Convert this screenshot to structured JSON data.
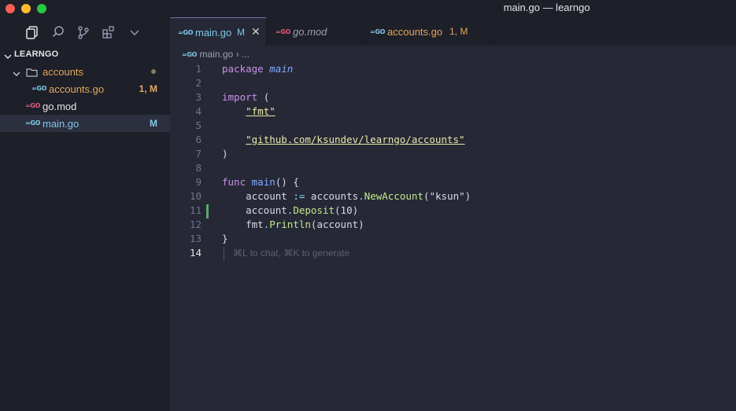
{
  "window": {
    "title": "main.go — learngo"
  },
  "colors": {
    "bg": "#262836",
    "sidebar": "#1d1f29",
    "modified": "#e2a75a",
    "error": "#e2a75a"
  },
  "activity_bar": [
    {
      "icon": "files-icon"
    },
    {
      "icon": "search-icon"
    },
    {
      "icon": "source-control-icon"
    },
    {
      "icon": "extensions-icon"
    },
    {
      "icon": "chevron-down-icon"
    }
  ],
  "explorer": {
    "header": "LEARNGO",
    "items": [
      {
        "label": "accounts",
        "type": "folder"
      },
      {
        "label": "accounts.go",
        "badge_lang": "=GO",
        "status": "1, M"
      },
      {
        "label": "go.mod",
        "badge_lang": "=GO"
      },
      {
        "label": "main.go",
        "badge_lang": "=GO",
        "status": "M"
      }
    ]
  },
  "tabs": [
    {
      "label": "main.go",
      "badge_lang": "=GO",
      "status": "M",
      "close": "✕"
    },
    {
      "label": "go.mod",
      "badge_lang": "=GO"
    },
    {
      "label": "accounts.go",
      "badge_lang": "=GO",
      "status": "1, M"
    }
  ],
  "breadcrumb": {
    "file": "main.go",
    "sep": "›",
    "more": "..."
  },
  "editor": {
    "line_numbers": [
      "1",
      "2",
      "3",
      "4",
      "5",
      "6",
      "7",
      "8",
      "9",
      "10",
      "11",
      "12",
      "13",
      "14"
    ],
    "hint": "⌘L to chat, ⌘K to generate",
    "tokens": {
      "package": "package",
      "main_pkg": "main",
      "import": "import",
      "paren_open": "(",
      "fmt_q1": "\"",
      "fmt": "fmt",
      "fmt_q2": "\"",
      "acc_q1": "\"",
      "acc_path": "github.com/ksundev/learngo/accounts",
      "acc_q2": "\"",
      "paren_close": ")",
      "func": "func",
      "main_fn": "main",
      "func_rest": "() {",
      "l10_var": "account",
      "l10_op": ":=",
      "l10_pkg": "accounts",
      "l10_dot": ".",
      "l10_fn": "NewAccount",
      "l10_open": "(",
      "l10_str": "\"ksun\"",
      "l10_close": ")",
      "l11_var": "account",
      "l11_dot": ".",
      "l11_fn": "Deposit",
      "l11_open": "(",
      "l11_num": "10",
      "l11_close": ")",
      "l12_pkg": "fmt",
      "l12_dot": ".",
      "l12_fn": "Println",
      "l12_open": "(",
      "l12_arg": "account",
      "l12_close": ")",
      "brace_close": "}"
    }
  }
}
